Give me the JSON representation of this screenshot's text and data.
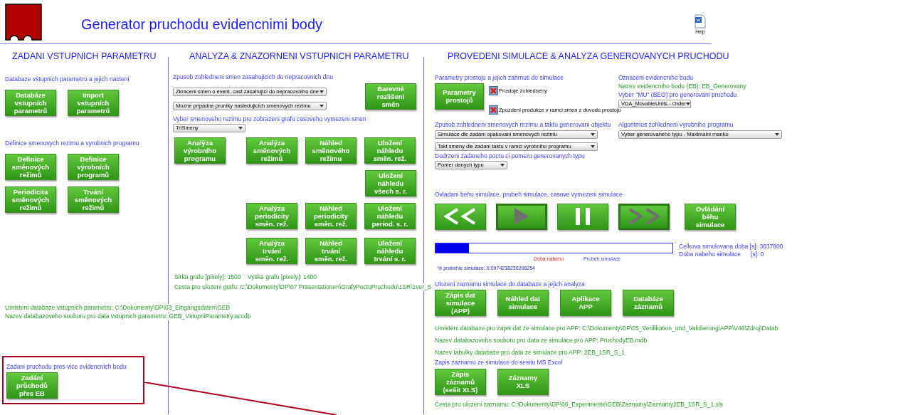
{
  "header": {
    "title": "Generator pruchodu evidencnimi body",
    "help_label": "Help"
  },
  "input_section": {
    "heading": "ZADANI VSTUPNICH PARAMETRU",
    "groups": [
      {
        "label": "Databaze vstupnich parametru a jejich nacteni",
        "rows": [
          [
            "Databáze\nvstupních\nparametrů",
            "Import\nvstupních\nparametrů"
          ]
        ]
      },
      {
        "label": "Definice smenovych rezimu a vyrobnich programu",
        "rows": [
          [
            "Definice\nsměnových\nrežimů",
            "Definice\nvýrobních\nprogramů"
          ],
          [
            "Periodicita\nsměnových\nrežimů",
            "Trvání\nsměnových\nrežimů"
          ]
        ]
      }
    ],
    "info_lines": [
      "Umisteni databaze vstupnich parametru: C:\\Dokumenty\\DP\\03_Eingangsdaten\\GEB",
      "Nazev databazoveho souboru pro data vstupnich parametru: GEB_VstupniParametry.accdb"
    ],
    "multi_point": {
      "label": "Zadani pruchodu pres vice evidencnich bodu",
      "button": "Zadání\nprůchodů\npřes EB",
      "highlighted": true
    }
  },
  "analysis_section": {
    "heading": "ANALYZA & ZNAZORNENI VSTUPNICH PARAMETRU",
    "shift_label": "Zpusob zohledneni smen zasahujicich do nepracovnich dnu",
    "dropdowns": [
      "Zkraceni smen o event. cast zasahujici do nepracovniho dne",
      "Mozne pripadne pruniky nasledujicich smenovych rezimu"
    ],
    "color_button": "Barevné\nrozlišení\nsměn",
    "regime_label": "Vyber smenoveho rezimu pro zobrazeni grafu casoveho vymezeni smen",
    "regime_dropdown": "TriSmeny",
    "main_buttons": [
      "Analýza\nvýrobního\nprogramu",
      "Analýza\nsměnových\nrežimů",
      "Náhled\nsměnového\nrežimu",
      "Uložení\nnáhledu\nsměn. rež."
    ],
    "save_all_button": "Uložení\nnáhledu\nvšech s. r.",
    "extra_rows": [
      [
        "Analýza\nperiodicity\nsměn. rež.",
        "Náhled\nperiodicity\nsměn. rež.",
        "Uložení\nnáhledu\nperiod. s. r."
      ],
      [
        "Analýza\ntrvání\nsměn. rež.",
        "Náhled\ntrvání\nsměn. rež.",
        "Uložení\nnáhledu\ntrvání s. r."
      ]
    ],
    "size_line": "Sirka grafu [pixely]: 1500    Vyska grafu [pixely]: 1400",
    "path_line": "Cesta pro ulozeni grafu: C:\\Dokumenty\\DP\\07 Präsentationen\\GrafyPoctuPruchodu\\1SR\\1ver_S"
  },
  "simulation_section": {
    "heading": "PROVEDENI SIMULACE & ANALYZA GENEROVANYCH PRUCHODU",
    "downtime": {
      "label": "Parametry prostoju a jejich zahrnuti do simulace",
      "button": "Parametry\nprostojů",
      "checkboxes": [
        {
          "label": "Prostoje zohledneny",
          "checked": false
        },
        {
          "label": "Zpozdeni produkce v ramci smen z duvodu prostoju",
          "checked": false
        }
      ]
    },
    "point": {
      "label": "Oznaceni evidencniho bodu",
      "name_line": "Nazev evidencniho bodu (EB): EB_Generovany",
      "mu_label": "Vyber \"MU\" (BEO) pro generovani pruchodu",
      "mu_dropdown": "VDA_MovableUnits - Order"
    },
    "shift": {
      "label": "Zpusob zohledneni smenovych rezimu a taktu generovani objektu",
      "dropdowns": [
        "Simulace dle zadani opakovani smenovych rezimu",
        "Takt smeny dle zadani taktu v ramci vyrobniho programu"
      ],
      "ratio_label": "Dodrzeni zadaneho poctu ci pomeru generovanych typu",
      "ratio_dropdown": "Pomer danych typu"
    },
    "algorithm": {
      "label": "Algoritmus zohledneni vyrobniho programu",
      "dropdown": "Vyber generovaneho typu - Maximalni manko"
    },
    "control": {
      "label": "Ovladani behu simulace, prubeh simulace, casove vymezeni simulace",
      "buttons": [
        {
          "kind": "rewind",
          "disabled": false
        },
        {
          "kind": "play",
          "disabled": true
        },
        {
          "kind": "pause",
          "disabled": false
        },
        {
          "kind": "forward",
          "disabled": true
        }
      ],
      "control_button": "Ovládání\nběhu\nsimulace"
    },
    "progress": {
      "level": 0.14,
      "ramp_label": "Doba nabehu",
      "run_label": "Prubeh simulace",
      "percent": "% probehle simulace: 0.0974218230206254",
      "total": "Celkova simulovana doba [s]: 3637800",
      "ramp_time": "Doba nabehu simulace      [s]: 0"
    },
    "storage": {
      "label": "Ulozeni zaznamu simulace do databaze a jejich analyza",
      "buttons": [
        "Zápis dat\nsimulace\n(APP)",
        "Náhled dat\nsimulace",
        "Aplikace\nAPP",
        "Databáze\nzáznamů"
      ],
      "info_lines": [
        "Umisteni databaze pro zapis dat ze simulace pro APP: C:\\Dokumenty\\DP\\05_Verifikation_und_Validierung\\APP\\V46\\Zdroj\\Datab",
        "Nazev databazoveho souboru pro data ze simulace pro APP: PruchodyEB.mdb",
        "Nazev tabulky databaze pro data ze simulace pro APP: 2EB_1SR_S_1"
      ],
      "excel_label": "Zapis zaznamu ze simulace do sesitu MS Excel",
      "excel_buttons": [
        "Zápis\nzáznamů\n(sešit XLS)",
        "Záznamy\nXLS"
      ],
      "path_line": "Cesta pro ulozeni zaznamu: C:\\Dokumenty\\DP\\06_Experimente\\GEB\\Zaznamy\\Zaznamy2EB_1SR_S_1.xls"
    }
  }
}
